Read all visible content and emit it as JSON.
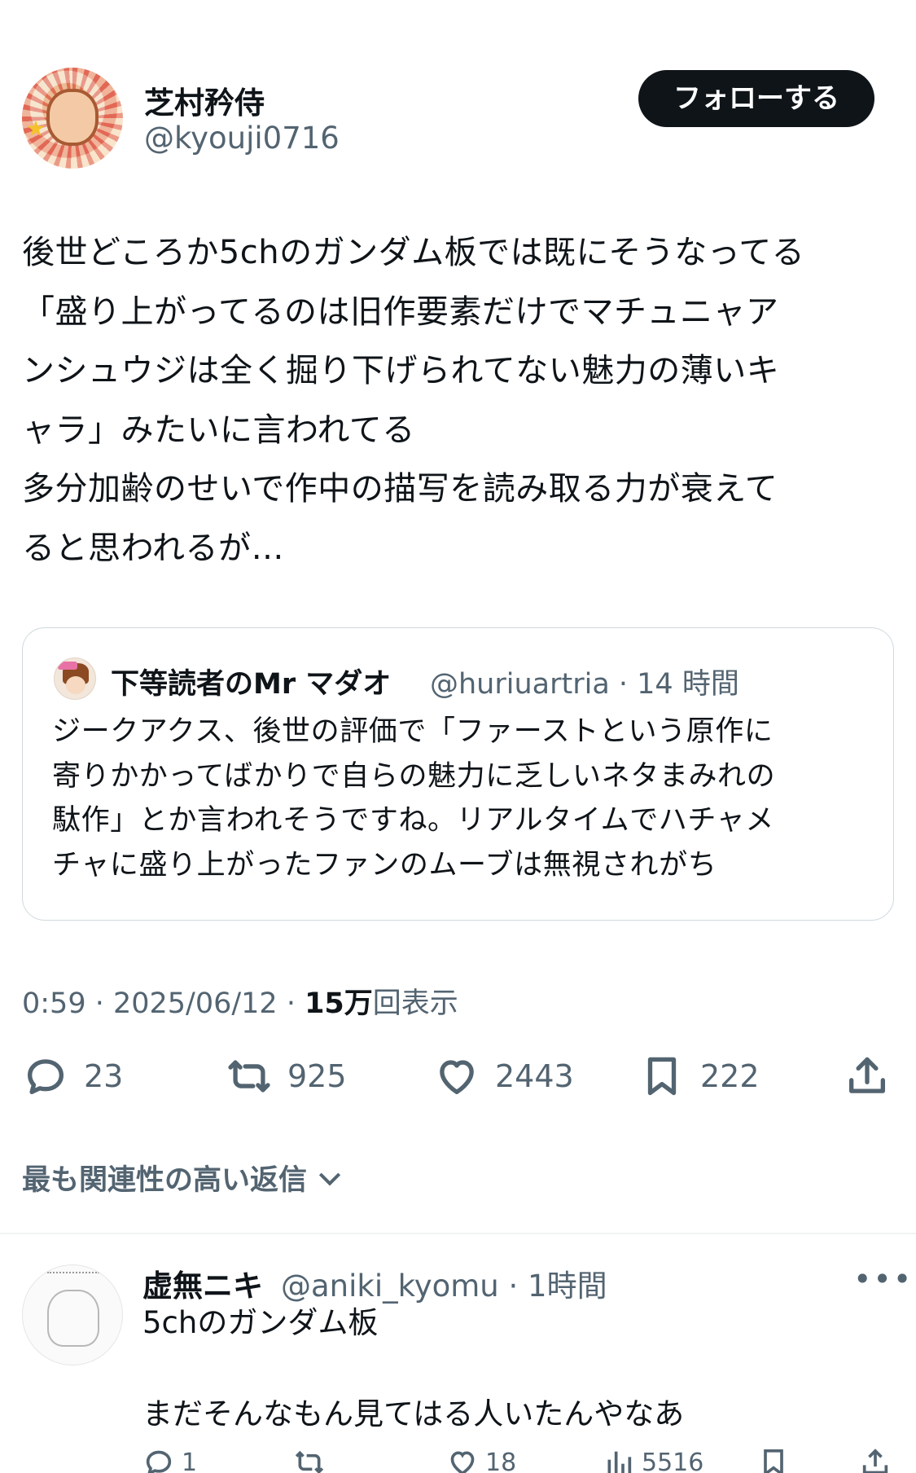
{
  "post": {
    "author_name": "芝村矜侍",
    "author_handle": "@kyouji0716",
    "follow_label": "フォローする",
    "body": "後世どころか5chのガンダム板では既にそうなってる\n「盛り上がってるのは旧作要素だけでマチュニャア\nンシュウジは全く掘り下げられてない魅力の薄いキ\nャラ」みたいに言われてる\n多分加齢のせいで作中の描写を読み取る力が衰えて\nると思われるが…",
    "timestamp": "0:59 · 2025/06/12 · ",
    "views_count": "15万",
    "views_label": "回表示",
    "actions": {
      "replies": "23",
      "reposts": "925",
      "likes": "2443",
      "bookmarks": "222"
    }
  },
  "quote": {
    "author_name": "下等読者のMr マダオ",
    "meta": "@huriuartria · 14 時間",
    "text": "ジークアクス、後世の評価で「ファーストという原作に\n寄りかかってばかりで自らの魅力に乏しいネタまみれの\n駄作」とか言われそうですね。リアルタイムでハチャメ\nチャに盛り上がったファンのムーブは無視されがち"
  },
  "replies_sort_label": "最も関連性の高い返信",
  "reply": {
    "author_name": "虚無ニキ",
    "meta": "@aniki_kyomu · 1時間",
    "more": "•••",
    "text": "5chのガンダム板\n\nまだそんなもん見てはる人いたんやなあ",
    "actions": {
      "replies": "1",
      "likes": "18",
      "views": "5516"
    }
  },
  "icons": {
    "reply": "reply-icon",
    "repost": "repost-icon",
    "like": "heart-icon",
    "bookmark": "bookmark-icon",
    "share": "share-icon",
    "chevron": "chevron-down-icon"
  }
}
